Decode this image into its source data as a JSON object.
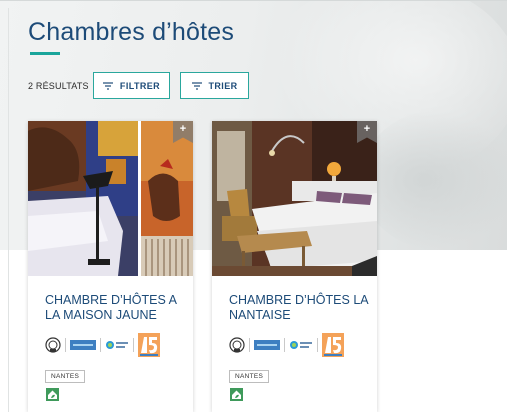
{
  "page": {
    "title": "Chambres d’hôtes",
    "results_count": "2 RÉSULTATS",
    "filter_button": "FILTRER",
    "sort_button": "TRIER"
  },
  "listings": [
    {
      "name": "CHAMBRE D’HÔTES A LA MAISON JAUNE",
      "city": "NANTES",
      "more_icon": "+"
    },
    {
      "name": "CHAMBRE D’HÔTES LA NANTAISE",
      "city": "NANTES",
      "more_icon": "+"
    }
  ],
  "colors": {
    "accent": "#2aa79d",
    "title": "#1d4b78"
  },
  "icons": {
    "filter": "filter-lines-icon",
    "sort": "sort-lines-icon",
    "labels": [
      "quality-seal-icon",
      "accueil-velo-icon",
      "loire-velo-icon",
      "anniversary-15-icon"
    ],
    "accommodation": "house-leaf-icon"
  }
}
